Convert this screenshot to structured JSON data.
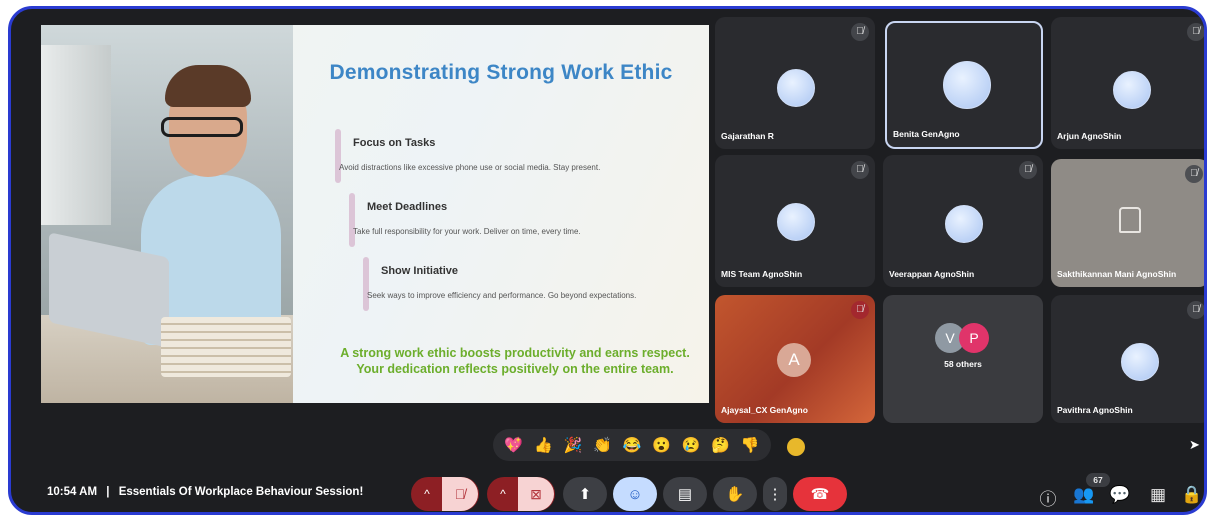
{
  "slide": {
    "title": "Demonstrating Strong Work Ethic",
    "points": [
      {
        "title": "Focus on Tasks",
        "desc": "Avoid distractions like excessive phone use or social media. Stay present."
      },
      {
        "title": "Meet Deadlines",
        "desc": "Take full responsibility for your work. Deliver on time, every time."
      },
      {
        "title": "Show Initiative",
        "desc": "Seek ways to improve efficiency and performance. Go beyond expectations."
      }
    ],
    "footer_line1": "A strong work ethic boosts productivity and earns respect.",
    "footer_line2": "Your dedication reflects positively on the entire team."
  },
  "participants": [
    {
      "name": "Gajarathan R",
      "muted": true
    },
    {
      "name": "Benita GenAgno",
      "muted": false,
      "active": true
    },
    {
      "name": "Arjun AgnoShin",
      "muted": true
    },
    {
      "name": "MIS Team AgnoShin",
      "muted": true
    },
    {
      "name": "Veerappan AgnoShin",
      "muted": true
    },
    {
      "name": "Sakthikannan Mani AgnoShin",
      "muted": true
    },
    {
      "name": "Ajaysal_CX GenAgno",
      "muted": true,
      "initial": "A"
    },
    {
      "name": "58 others",
      "initials": [
        "V",
        "P"
      ]
    },
    {
      "name": "Pavithra AgnoShin",
      "muted": true
    }
  ],
  "reactions": [
    "💖",
    "👍",
    "🎉",
    "👏",
    "😂",
    "😮",
    "😢",
    "🤔",
    "👎"
  ],
  "meeting": {
    "time": "10:54 AM",
    "separator": "|",
    "title": "Essentials Of Workplace Behaviour Session!"
  },
  "people_count": "67",
  "icons": {
    "mute": "🎙",
    "chevron": "^",
    "camera_off": "📷",
    "present": "⬆",
    "emoji": "☺",
    "captions": "▤",
    "hand": "✋",
    "more": "⋮",
    "hangup": "☎",
    "info": "ⓘ",
    "people": "👥",
    "chat": "💬",
    "activities": "▦",
    "host_controls": "🔒"
  },
  "colors": {
    "accent_blue": "#3d86c6",
    "footer_green": "#6cae2c",
    "hangup_red": "#e6333b",
    "frame_blue": "#2a3bd1"
  }
}
